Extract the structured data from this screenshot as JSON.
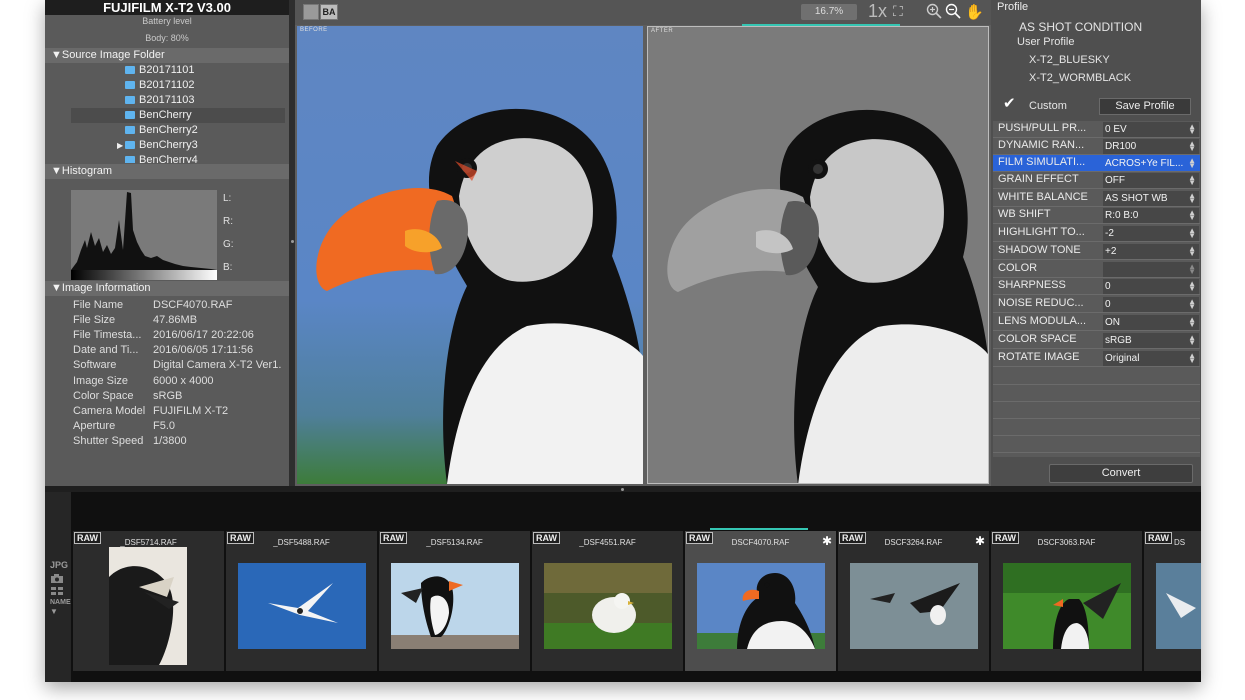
{
  "app": {
    "title": "FUJIFILM X-T2   V3.00",
    "battery_label": "Battery level",
    "battery_body": "Body: 80%"
  },
  "source_folder": {
    "header": "▼Source Image Folder",
    "folders": [
      "B20171101",
      "B20171102",
      "B20171103",
      "BenCherry",
      "BenCherry2",
      "BenCherry3",
      "BenCherry4"
    ],
    "selected": "BenCherry"
  },
  "histogram": {
    "header": "▼Histogram",
    "labels": [
      "L:",
      "R:",
      "G:",
      "B:"
    ]
  },
  "image_info": {
    "header": "▼Image Information",
    "rows": [
      {
        "k": "File Name",
        "v": "DSCF4070.RAF"
      },
      {
        "k": "File Size",
        "v": "47.86MB"
      },
      {
        "k": "File Timesta...",
        "v": "2016/06/17 20:22:06"
      },
      {
        "k": "Date and Ti...",
        "v": "2016/06/05 17:11:56"
      },
      {
        "k": "Software",
        "v": "Digital Camera X-T2 Ver1."
      },
      {
        "k": "Image Size",
        "v": "6000 x 4000"
      },
      {
        "k": "Color Space",
        "v": "sRGB"
      },
      {
        "k": "Camera Model",
        "v": "FUJIFILM X-T2"
      },
      {
        "k": "Aperture",
        "v": "F5.0"
      },
      {
        "k": "Shutter Speed",
        "v": "1/3800"
      }
    ]
  },
  "toolbar": {
    "zoom": "16.7%",
    "zoom_1x": "1x",
    "before_label": "BEFORE",
    "after_label": "AFTER",
    "ba_label": "BA"
  },
  "profile": {
    "title": "Profile",
    "as_shot": "AS SHOT CONDITION",
    "user_profile": "User Profile",
    "profiles": [
      "X-T2_BLUESKY",
      "X-T2_WORMBLACK"
    ],
    "custom": "Custom",
    "save_label": "Save Profile"
  },
  "params": [
    {
      "k": "PUSH/PULL PR...",
      "v": "0 EV"
    },
    {
      "k": "DYNAMIC RAN...",
      "v": "DR100"
    },
    {
      "k": "FILM SIMULATI...",
      "v": "ACROS+Ye FIL..."
    },
    {
      "k": "GRAIN EFFECT",
      "v": "OFF"
    },
    {
      "k": "WHITE BALANCE",
      "v": "AS SHOT WB"
    },
    {
      "k": "WB SHIFT",
      "v": "R:0 B:0"
    },
    {
      "k": "HIGHLIGHT TO...",
      "v": "-2"
    },
    {
      "k": "SHADOW TONE",
      "v": "+2"
    },
    {
      "k": "COLOR",
      "v": ""
    },
    {
      "k": "SHARPNESS",
      "v": "0"
    },
    {
      "k": "NOISE REDUC...",
      "v": "0"
    },
    {
      "k": "LENS MODULA...",
      "v": "ON"
    },
    {
      "k": "COLOR SPACE",
      "v": "sRGB"
    },
    {
      "k": "ROTATE IMAGE",
      "v": "Original"
    }
  ],
  "selected_param": "FILM SIMULATI...",
  "convert_label": "Convert",
  "filmstrip": {
    "side_labels": [
      "JPG",
      "NAME"
    ],
    "thumbs": [
      {
        "badge": "RAW",
        "name": "_DSF5714.RAF",
        "star": false
      },
      {
        "badge": "RAW",
        "name": "_DSF5488.RAF",
        "star": false
      },
      {
        "badge": "RAW",
        "name": "_DSF5134.RAF",
        "star": false
      },
      {
        "badge": "RAW",
        "name": "_DSF4551.RAF",
        "star": false
      },
      {
        "badge": "RAW",
        "name": "DSCF4070.RAF",
        "star": true
      },
      {
        "badge": "RAW",
        "name": "DSCF3264.RAF",
        "star": true
      },
      {
        "badge": "RAW",
        "name": "DSCF3063.RAF",
        "star": false
      },
      {
        "badge": "RAW",
        "name": "DS",
        "star": false
      }
    ],
    "selected_index": 4
  },
  "colors": {
    "accent": "#35c6b3",
    "selection_blue": "#2a63d8",
    "folder_icon": "#5fb4ef"
  }
}
